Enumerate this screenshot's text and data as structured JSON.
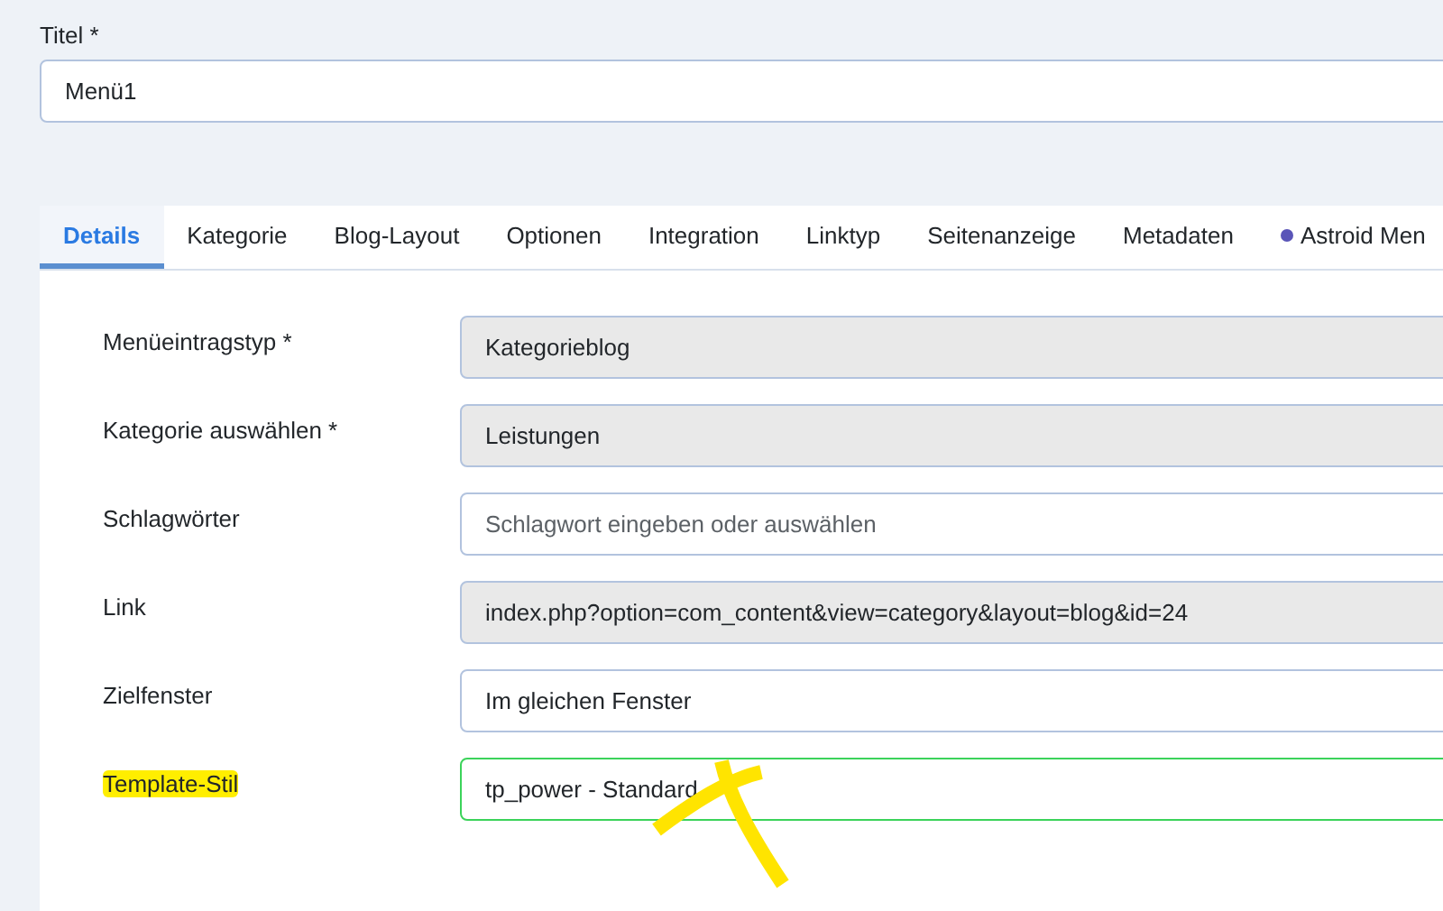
{
  "title_field": {
    "label": "Titel *",
    "value": "Menü1"
  },
  "tabs": [
    {
      "label": "Details",
      "selected": true,
      "kind": "plain"
    },
    {
      "label": "Kategorie",
      "selected": false,
      "kind": "plain"
    },
    {
      "label": "Blog-Layout",
      "selected": false,
      "kind": "plain"
    },
    {
      "label": "Optionen",
      "selected": false,
      "kind": "plain"
    },
    {
      "label": "Integration",
      "selected": false,
      "kind": "plain"
    },
    {
      "label": "Linktyp",
      "selected": false,
      "kind": "plain"
    },
    {
      "label": "Seitenanzeige",
      "selected": false,
      "kind": "plain"
    },
    {
      "label": "Metadaten",
      "selected": false,
      "kind": "plain"
    },
    {
      "label": "Astroid Men",
      "selected": false,
      "kind": "dot"
    }
  ],
  "fields": [
    {
      "label": "Menüeintragstyp *",
      "kind": "readonly",
      "value": "Kategorieblog",
      "highlighted": false,
      "valid": false,
      "crossed": false
    },
    {
      "label": "Kategorie auswählen *",
      "kind": "readonly",
      "value": "Leistungen",
      "highlighted": false,
      "valid": false,
      "crossed": false
    },
    {
      "label": "Schlagwörter",
      "kind": "text",
      "placeholder": "Schlagwort eingeben oder auswählen",
      "highlighted": false,
      "valid": false,
      "crossed": false
    },
    {
      "label": "Link",
      "kind": "readonly",
      "value": "index.php?option=com_content&view=category&layout=blog&id=24",
      "highlighted": false,
      "valid": false,
      "crossed": false
    },
    {
      "label": "Zielfenster",
      "kind": "text",
      "value": "Im gleichen Fenster",
      "highlighted": false,
      "valid": false,
      "crossed": false
    },
    {
      "label": "Template-Stil",
      "kind": "text",
      "value": "tp_power - Standard",
      "highlighted": true,
      "valid": true,
      "crossed": true
    }
  ]
}
